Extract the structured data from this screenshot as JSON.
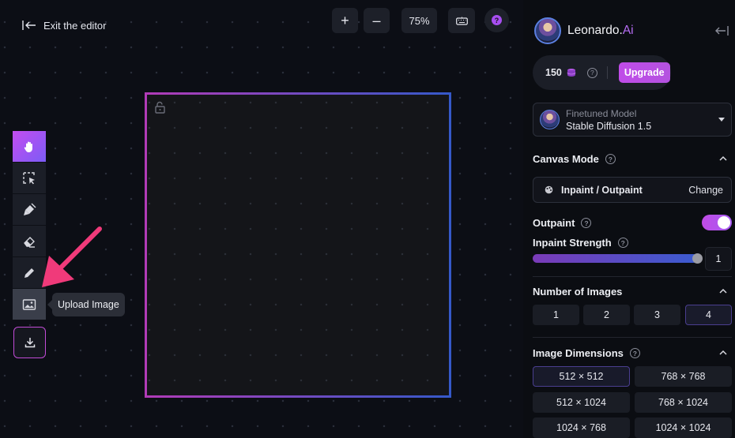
{
  "editor": {
    "exit_label": "Exit the editor",
    "zoom_in_label": "+",
    "zoom_out_label": "–",
    "zoom_level": "75%",
    "help_label": "?"
  },
  "toolbar": {
    "tools": [
      "pan",
      "select",
      "mask",
      "erase",
      "draw",
      "upload-image"
    ],
    "active_tool": "pan",
    "hovered_tool": "upload-image",
    "tooltip": "Upload Image"
  },
  "sidebar": {
    "brand_name": "Leonardo.",
    "brand_suffix": "Ai",
    "tokens": "150",
    "upgrade_label": "Upgrade",
    "model": {
      "label": "Finetuned Model",
      "name": "Stable Diffusion 1.5"
    },
    "canvas_mode": {
      "title": "Canvas Mode",
      "mode": "Inpaint / Outpaint",
      "change_label": "Change"
    },
    "outpaint": {
      "label": "Outpaint",
      "enabled": true
    },
    "inpaint_strength": {
      "label": "Inpaint Strength",
      "value": "1",
      "fill": 1.0
    },
    "number_of_images": {
      "title": "Number of Images",
      "options": [
        "1",
        "2",
        "3",
        "4"
      ],
      "selected": "4"
    },
    "image_dimensions": {
      "title": "Image Dimensions",
      "options": [
        "512 × 512",
        "768 × 768",
        "512 × 1024",
        "768 × 1024",
        "1024 × 768",
        "1024 × 1024"
      ],
      "selected": "512 × 512"
    }
  },
  "colors": {
    "accent": "#c04ce9",
    "frame_left": "#b23bb7",
    "frame_right": "#3559c9",
    "annotation_arrow": "#f03a7a"
  }
}
